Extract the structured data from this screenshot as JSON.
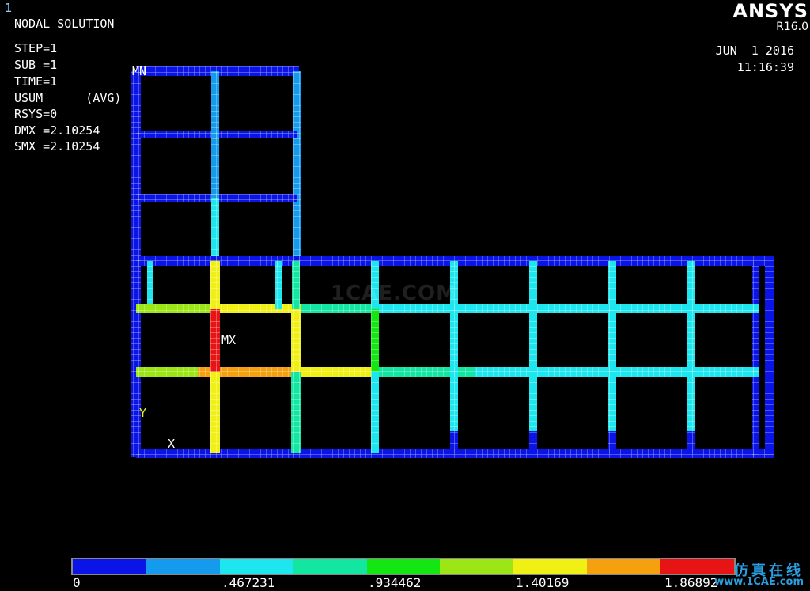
{
  "window": {
    "number": "1"
  },
  "header": {
    "title": "NODAL SOLUTION",
    "info_lines": [
      "STEP=1",
      "SUB =1",
      "TIME=1",
      "USUM      (AVG)",
      "RSYS=0",
      "DMX =2.10254",
      "SMX =2.10254"
    ],
    "brand": "ANSYS",
    "version": "R16.0",
    "date": "JUN  1 2016",
    "time": "11:16:39"
  },
  "plot": {
    "min_marker": "MN",
    "max_marker": "MX",
    "axis_y_label": "Y",
    "axis_x_label": "X",
    "center_watermark": "1CAE.COM"
  },
  "legend": {
    "colors": [
      "#0b14e6",
      "#159bee",
      "#1ee6ee",
      "#12e6a0",
      "#14e614",
      "#9be614",
      "#f0f014",
      "#f5a00f",
      "#e61414"
    ],
    "labels": [
      "0",
      ".467231",
      ".934462",
      "1.40169",
      "1.86892"
    ]
  },
  "watermark": {
    "chinese": "仿真在线",
    "url": "www.1CAE.com"
  }
}
